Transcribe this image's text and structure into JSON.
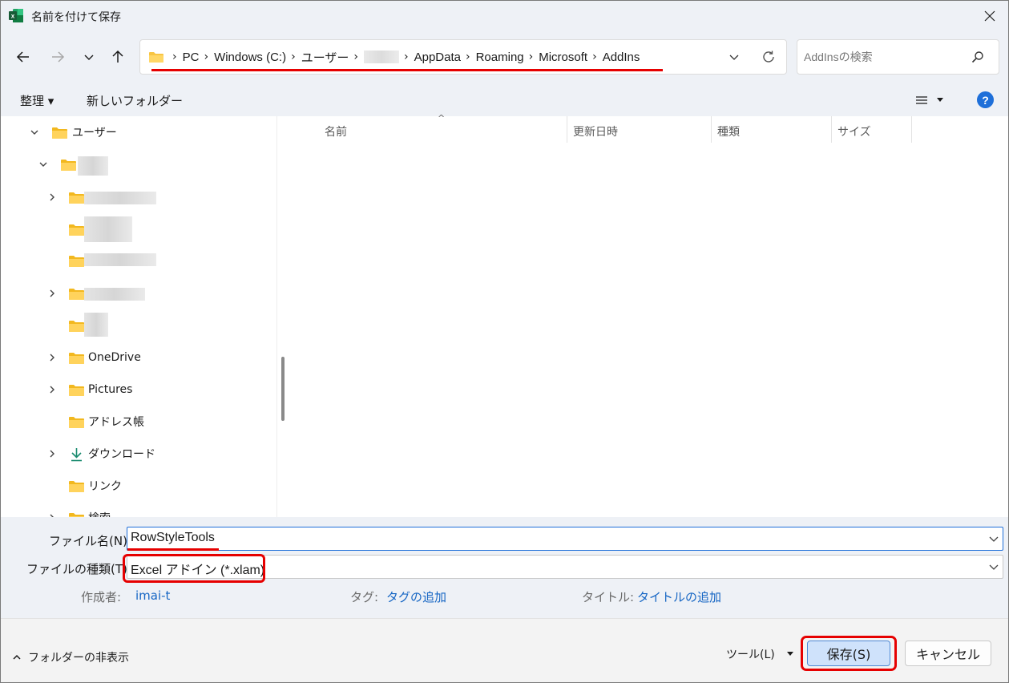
{
  "window": {
    "title": "名前を付けて保存",
    "app_icon": "excel-icon",
    "close_icon": "close-icon"
  },
  "nav": {
    "back_icon": "arrow-left-icon",
    "forward_icon": "arrow-right-icon",
    "recent_icon": "chevron-down-icon",
    "up_icon": "arrow-up-icon",
    "breadcrumb": [
      "PC",
      "Windows (C:)",
      "ユーザー",
      "",
      "AppData",
      "Roaming",
      "Microsoft",
      "AddIns"
    ],
    "refresh_icon": "refresh-icon",
    "search_placeholder": "AddInsの検索"
  },
  "toolbar": {
    "organize": "整理 ▾",
    "new_folder": "新しいフォルダー",
    "help": "?"
  },
  "tree": {
    "items": [
      {
        "label": "ユーザー",
        "chevron": "down"
      },
      {
        "label": "",
        "chevron": "down",
        "blurred": true
      },
      {
        "label": "",
        "chevron": "right",
        "blurred": true
      },
      {
        "label": "",
        "chevron": "none",
        "blurred": true
      },
      {
        "label": "",
        "chevron": "none",
        "blurred": true
      },
      {
        "label": "",
        "chevron": "right",
        "blurred": true
      },
      {
        "label": "",
        "chevron": "none",
        "blurred": true
      },
      {
        "label": "OneDrive",
        "chevron": "right"
      },
      {
        "label": "Pictures",
        "chevron": "right"
      },
      {
        "label": "アドレス帳",
        "chevron": "none"
      },
      {
        "label": "ダウンロード",
        "chevron": "right",
        "icon": "download-icon"
      },
      {
        "label": "リンク",
        "chevron": "none"
      },
      {
        "label": "検索",
        "chevron": "right"
      }
    ]
  },
  "filelist": {
    "columns": [
      "名前",
      "更新日時",
      "種類",
      "サイズ"
    ]
  },
  "form": {
    "filename_label": "ファイル名(N):",
    "filename_value": "RowStyleTools",
    "filetype_label": "ファイルの種類(T):",
    "filetype_value": "Excel アドイン (*.xlam)",
    "author_label": "作成者:",
    "author_value": "imai-t",
    "tags_label": "タグ:",
    "tags_value": "タグの追加",
    "title_label": "タイトル:",
    "title_value": "タイトルの追加"
  },
  "footer": {
    "hide_folders": "フォルダーの非表示",
    "tools": "ツール(L)",
    "save": "保存(S)",
    "cancel": "キャンセル"
  },
  "colors": {
    "accent": "#1e6fd9",
    "highlight_red": "#e60000",
    "chrome_bg": "#eef1f6",
    "folder_yellow": "#f8c543"
  }
}
